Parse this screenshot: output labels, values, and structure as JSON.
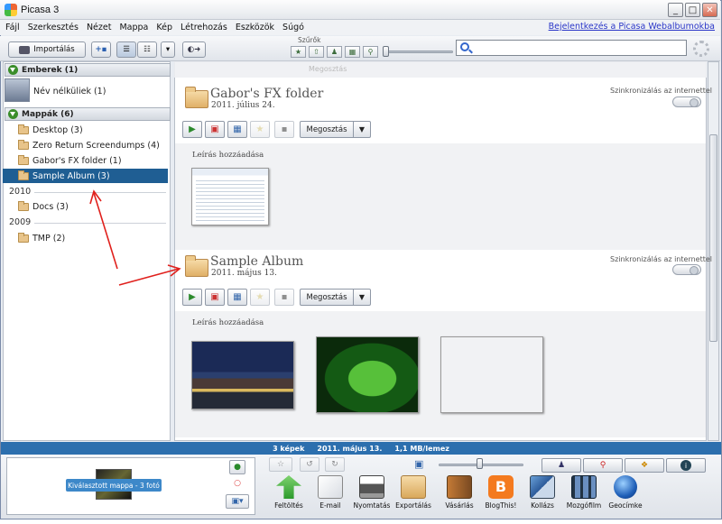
{
  "window": {
    "title": "Picasa 3",
    "min": "_",
    "max": "□",
    "close": "✕"
  },
  "menu": [
    "Fájl",
    "Szerkesztés",
    "Nézet",
    "Mappa",
    "Kép",
    "Létrehozás",
    "Eszközök",
    "Súgó"
  ],
  "login_link": "Bejelentkezés a Picasa Webalbumokba",
  "toolbar": {
    "import_label": "Importálás",
    "filters_label": "Szűrők"
  },
  "left": {
    "people_header": "Emberek (1)",
    "people_item": "Név nélküliek (1)",
    "folders_header": "Mappák (6)",
    "folders_top": [
      "Desktop (3)",
      "Zero Return Screendumps (4)",
      "Gabor's FX folder (1)",
      "Sample Album (3)"
    ],
    "year_2010": "2010",
    "folders_2010": [
      "Docs (3)"
    ],
    "year_2009": "2009",
    "folders_2009": [
      "TMP (2)"
    ]
  },
  "main": {
    "ghost_share": "Megosztás",
    "albums": [
      {
        "title": "Gabor's FX folder",
        "date": "2011. július 24.",
        "sync": "Szinkronizálás az internettel",
        "share": "Megosztás",
        "desc": "Leírás hozzáadása"
      },
      {
        "title": "Sample Album",
        "date": "2011. május 13.",
        "sync": "Szinkronizálás az internettel",
        "share": "Megosztás",
        "desc": "Leírás hozzáadása"
      }
    ]
  },
  "status": {
    "count": "3 képek",
    "date": "2011. május 13.",
    "size": "1,1 MB/lemez"
  },
  "tray": {
    "badge": "Kiválasztott mappa - 3 fotó"
  },
  "tools": [
    "Feltöltés",
    "E-mail",
    "Nyomtatás",
    "Exportálás",
    "Vásárlás",
    "BlogThis!",
    "Kollázs",
    "Mozgófilm",
    "Geocímke"
  ]
}
